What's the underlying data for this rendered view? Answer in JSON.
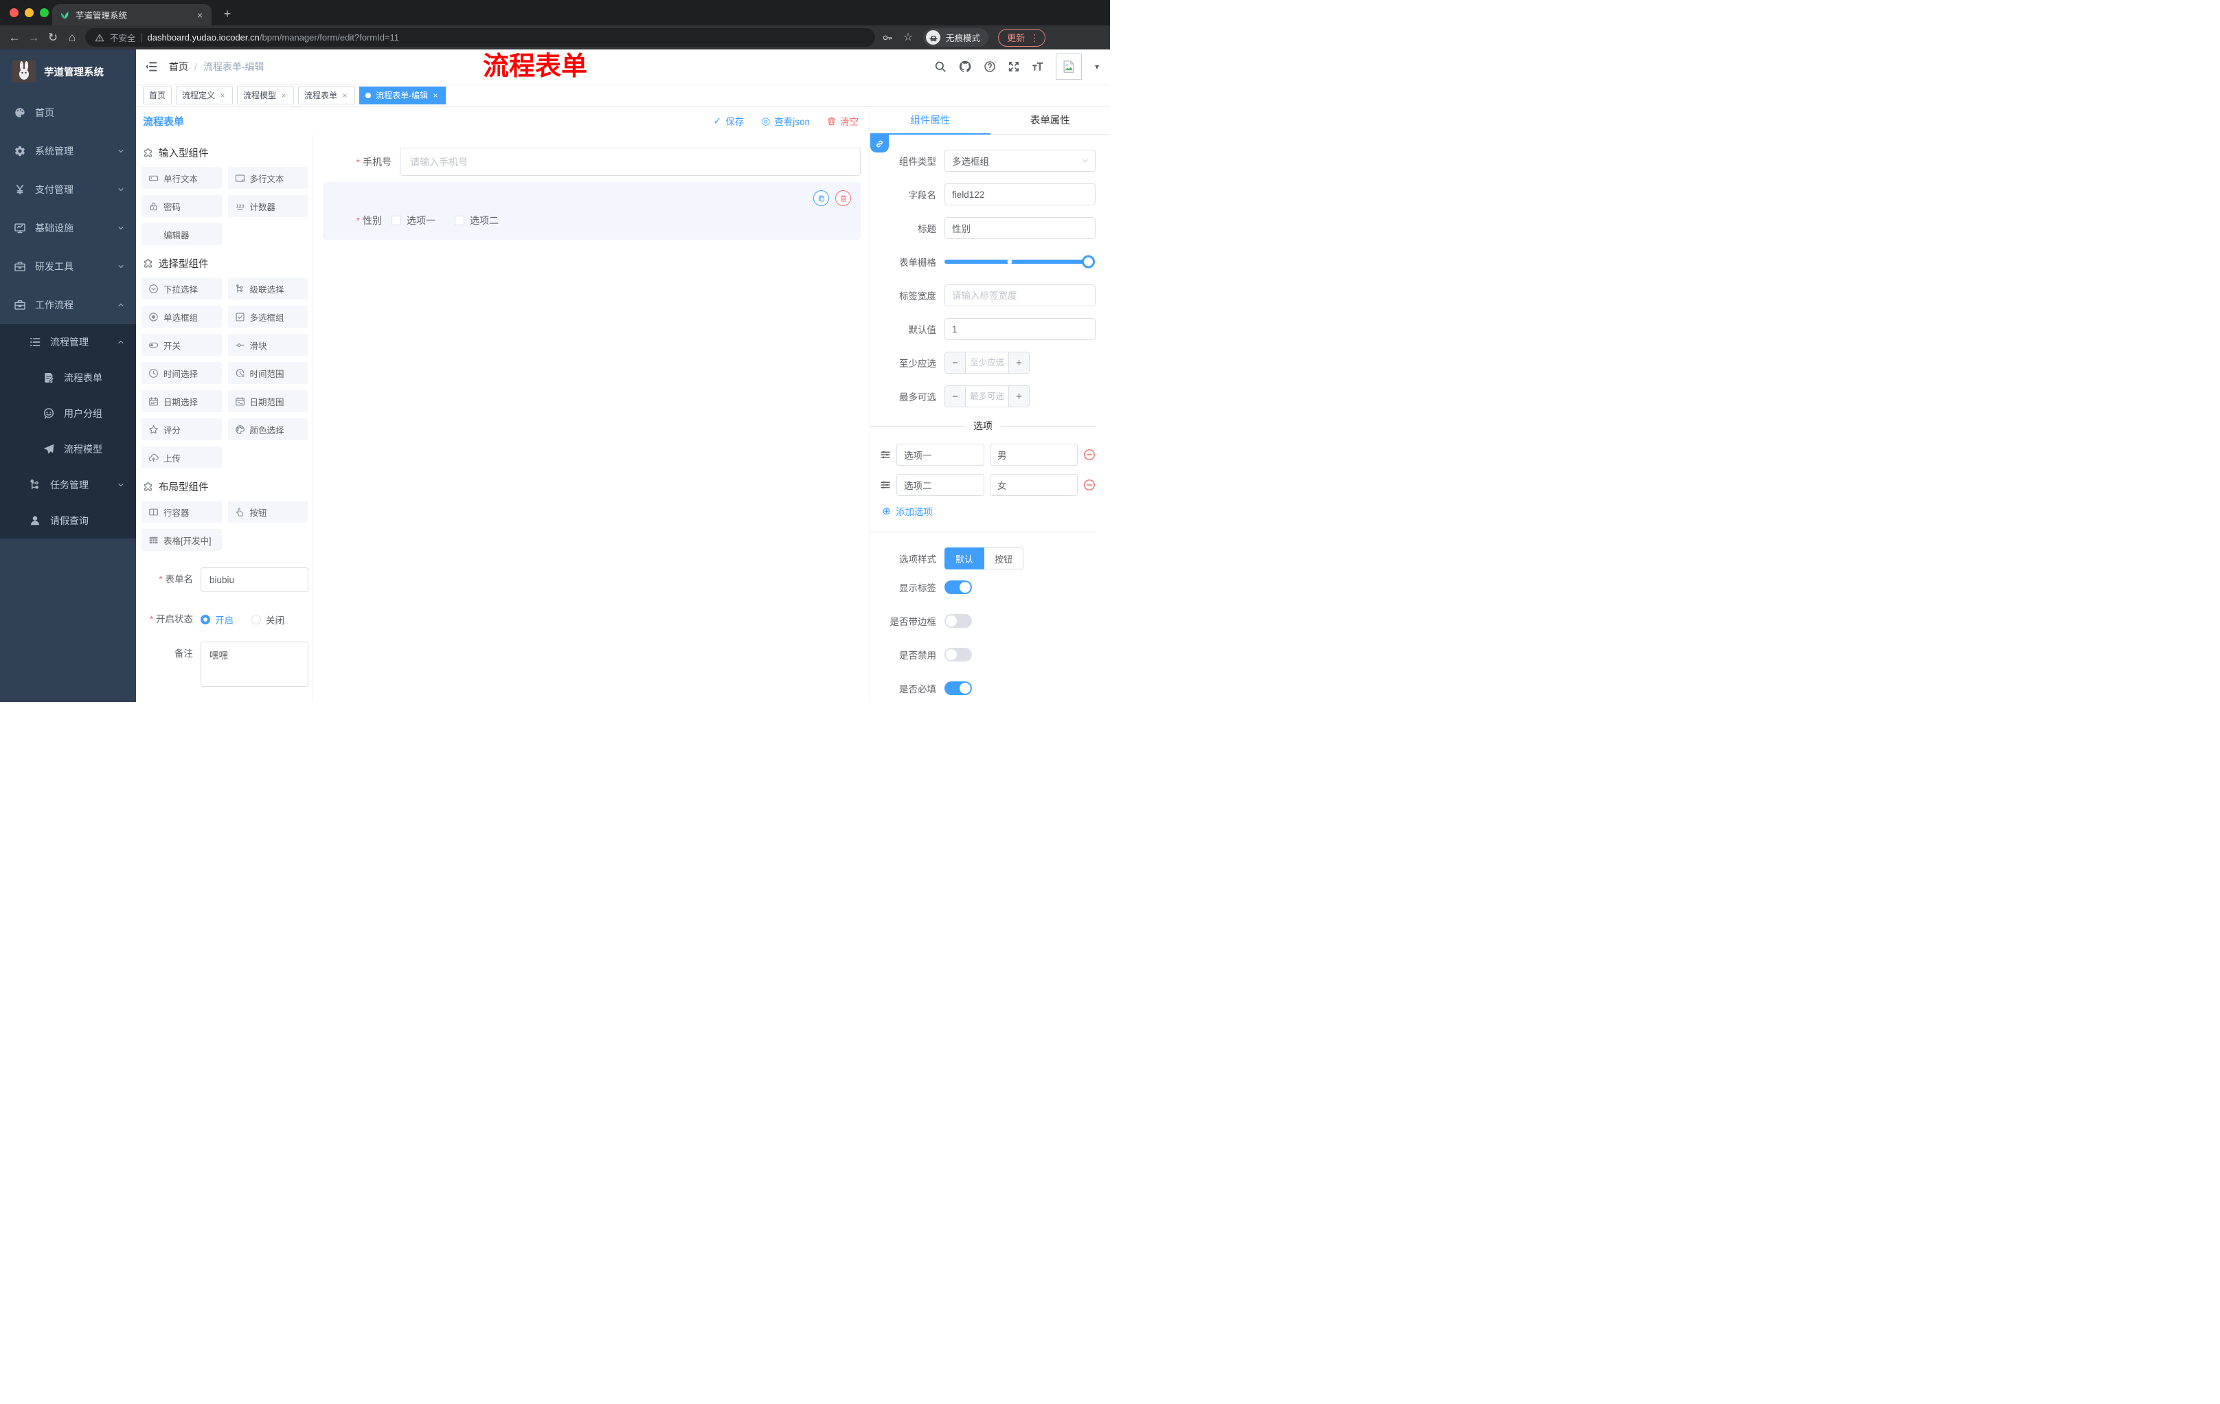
{
  "colors": {
    "primary": "#409eff",
    "danger": "#f56c6c",
    "annotation_red": "#ff0000",
    "sidebar_bg": "#304156",
    "sidebar_submenu_bg": "#1f2d3d"
  },
  "browser": {
    "tab_title": "芋道管理系统",
    "security_label": "不安全",
    "url_domain": "dashboard.yudao.iocoder.cn",
    "url_path": "/bpm/manager/form/edit?formId=11",
    "incognito_label": "无痕模式",
    "update_label": "更新"
  },
  "header": {
    "breadcrumb_home": "首页",
    "breadcrumb_sep": "/",
    "breadcrumb_current": "流程表单-编辑",
    "annotation": "流程表单"
  },
  "tags": [
    {
      "label": "首页",
      "closable": false,
      "active": false
    },
    {
      "label": "流程定义",
      "closable": true,
      "active": false
    },
    {
      "label": "流程模型",
      "closable": true,
      "active": false
    },
    {
      "label": "流程表单",
      "closable": true,
      "active": false
    },
    {
      "label": "流程表单-编辑",
      "closable": true,
      "active": true
    }
  ],
  "sidebar": {
    "logo_title": "芋道管理系统",
    "menu": [
      {
        "label": "首页",
        "icon": "dashboard-icon",
        "level": 1
      },
      {
        "label": "系统管理",
        "icon": "gear-icon",
        "level": 1,
        "chevron": "down"
      },
      {
        "label": "支付管理",
        "icon": "yen-icon",
        "level": 1,
        "chevron": "down"
      },
      {
        "label": "基础设施",
        "icon": "monitor-icon",
        "level": 1,
        "chevron": "down"
      },
      {
        "label": "研发工具",
        "icon": "toolbox-icon",
        "level": 1,
        "chevron": "down"
      },
      {
        "label": "工作流程",
        "icon": "toolbox-icon",
        "level": 1,
        "chevron": "up"
      },
      {
        "label": "流程管理",
        "icon": "list-icon",
        "level": 2,
        "chevron": "up",
        "sub": true
      },
      {
        "label": "流程表单",
        "icon": "form-doc-icon",
        "level": 3,
        "sub": true
      },
      {
        "label": "用户分组",
        "icon": "user-group-icon",
        "level": 3,
        "sub": true
      },
      {
        "label": "流程模型",
        "icon": "send-icon",
        "level": 3,
        "sub": true
      },
      {
        "label": "任务管理",
        "icon": "flow-icon",
        "level": 2,
        "chevron": "down",
        "sub": true
      },
      {
        "label": "请假查询",
        "icon": "user-icon",
        "level": 2,
        "sub": true
      }
    ]
  },
  "designer": {
    "title": "流程表单",
    "actions": {
      "save": "保存",
      "view_json": "查看json",
      "clear": "清空"
    },
    "palette_sections": [
      {
        "title": "输入型组件",
        "items": [
          {
            "label": "单行文本",
            "icon": "input-icon"
          },
          {
            "label": "多行文本",
            "icon": "textarea-icon"
          },
          {
            "label": "密码",
            "icon": "lock-icon"
          },
          {
            "label": "计数器",
            "icon": "counter-icon"
          },
          {
            "label": "编辑器",
            "icon": "blank-icon"
          }
        ]
      },
      {
        "title": "选择型组件",
        "items": [
          {
            "label": "下拉选择",
            "icon": "select-icon"
          },
          {
            "label": "级联选择",
            "icon": "cascader-icon"
          },
          {
            "label": "单选框组",
            "icon": "radio-icon"
          },
          {
            "label": "多选框组",
            "icon": "checkbox-icon"
          },
          {
            "label": "开关",
            "icon": "switch-icon"
          },
          {
            "label": "滑块",
            "icon": "slider-icon"
          },
          {
            "label": "时间选择",
            "icon": "clock-icon"
          },
          {
            "label": "时间范围",
            "icon": "time-range-icon"
          },
          {
            "label": "日期选择",
            "icon": "calendar-icon"
          },
          {
            "label": "日期范围",
            "icon": "date-range-icon"
          },
          {
            "label": "评分",
            "icon": "star-icon"
          },
          {
            "label": "颜色选择",
            "icon": "color-icon"
          },
          {
            "label": "上传",
            "icon": "upload-icon"
          }
        ]
      },
      {
        "title": "布局型组件",
        "items": [
          {
            "label": "行容器",
            "icon": "row-icon"
          },
          {
            "label": "按钮",
            "icon": "button-icon"
          },
          {
            "label": "表格[开发中]",
            "icon": "table-icon"
          }
        ]
      }
    ],
    "meta": {
      "name_label": "表单名",
      "name_value": "biubiu",
      "status_label": "开启状态",
      "status_on": "开启",
      "status_off": "关闭",
      "remark_label": "备注",
      "remark_value": "嘿嘿"
    },
    "canvas": {
      "phone_label": "手机号",
      "phone_placeholder": "请输入手机号",
      "gender_label": "性别",
      "gender_options": [
        "选项一",
        "选项二"
      ]
    }
  },
  "props": {
    "tab_component": "组件属性",
    "tab_form": "表单属性",
    "type_label": "组件类型",
    "type_value": "多选框组",
    "field_label": "字段名",
    "field_value": "field122",
    "title_label": "标题",
    "title_value": "性别",
    "grid_label": "表单栅格",
    "width_label": "标签宽度",
    "width_placeholder": "请输入标签宽度",
    "default_label": "默认值",
    "default_value": "1",
    "min_label": "至少应选",
    "min_placeholder": "至少应选",
    "max_label": "最多可选",
    "max_placeholder": "最多可选",
    "options_title": "选项",
    "options": [
      {
        "label": "选项一",
        "value": "男"
      },
      {
        "label": "选项二",
        "value": "女"
      }
    ],
    "add_option": "添加选项",
    "style_label": "选项样式",
    "style_default": "默认",
    "style_button": "按钮",
    "toggles": [
      {
        "label": "显示标签",
        "on": true
      },
      {
        "label": "是否带边框",
        "on": false
      },
      {
        "label": "是否禁用",
        "on": false
      },
      {
        "label": "是否必填",
        "on": true
      }
    ]
  }
}
